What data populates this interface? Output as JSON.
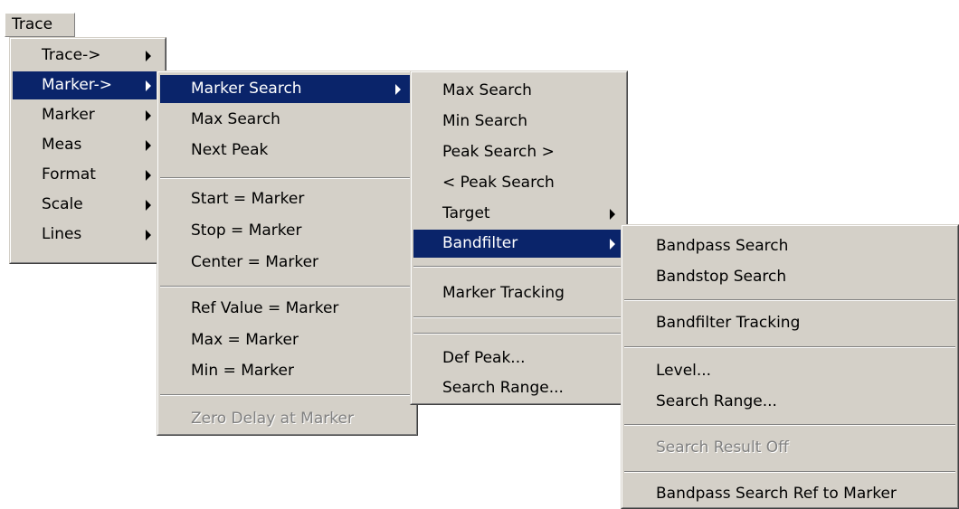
{
  "menubar": {
    "trace_label": "Trace"
  },
  "trace_menu": {
    "items": [
      {
        "label": "Trace->"
      },
      {
        "label": "Marker->"
      },
      {
        "label": "Marker"
      },
      {
        "label": "Meas"
      },
      {
        "label": "Format"
      },
      {
        "label": "Scale"
      },
      {
        "label": "Lines"
      }
    ]
  },
  "marker_submenu": {
    "items": [
      {
        "label": "Marker Search"
      },
      {
        "label": "Max Search"
      },
      {
        "label": "Next Peak"
      },
      {
        "label": "Start = Marker"
      },
      {
        "label": "Stop = Marker"
      },
      {
        "label": "Center = Marker"
      },
      {
        "label": "Ref Value = Marker"
      },
      {
        "label": "Max = Marker"
      },
      {
        "label": "Min = Marker"
      },
      {
        "label": "Zero Delay at Marker"
      }
    ]
  },
  "marker_search_submenu": {
    "items": [
      {
        "label": "Max Search"
      },
      {
        "label": "Min Search"
      },
      {
        "label": "Peak Search >"
      },
      {
        "label": "< Peak Search"
      },
      {
        "label": "Target"
      },
      {
        "label": "Bandfilter"
      },
      {
        "label": "Marker Tracking"
      },
      {
        "label": "Def Peak..."
      },
      {
        "label": "Search Range..."
      }
    ]
  },
  "bandfilter_submenu": {
    "items": [
      {
        "label": "Bandpass Search"
      },
      {
        "label": "Bandstop Search"
      },
      {
        "label": "Bandfilter Tracking"
      },
      {
        "label": "Level..."
      },
      {
        "label": "Search Range..."
      },
      {
        "label": "Search Result Off"
      },
      {
        "label": "Bandpass Search Ref to Marker"
      }
    ]
  },
  "colors": {
    "menu_face": "#d4d0c8",
    "highlight": "#0a246a",
    "highlight_text": "#ffffff",
    "disabled_text": "#808080"
  }
}
